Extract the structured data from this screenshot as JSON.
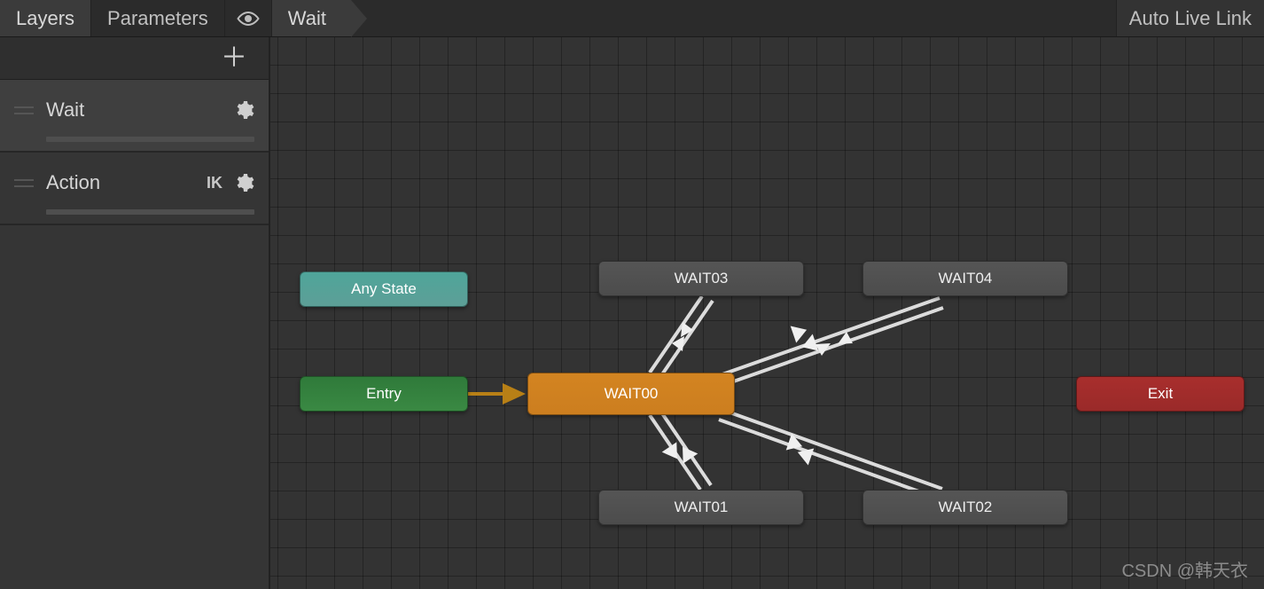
{
  "topbar": {
    "tabs": {
      "layers": "Layers",
      "parameters": "Parameters"
    },
    "breadcrumb": "Wait",
    "auto_live_link": "Auto Live Link"
  },
  "sidebar": {
    "layers": [
      {
        "name": "Wait",
        "ik": false,
        "selected": true
      },
      {
        "name": "Action",
        "ik": true,
        "selected": false
      }
    ]
  },
  "graph": {
    "nodes": {
      "any_state": "Any State",
      "entry": "Entry",
      "default": "WAIT00",
      "wait01": "WAIT01",
      "wait02": "WAIT02",
      "wait03": "WAIT03",
      "wait04": "WAIT04",
      "exit": "Exit"
    }
  },
  "watermark": "CSDN @韩天衣",
  "icons": {
    "plus": "＋",
    "ik": "IK"
  }
}
